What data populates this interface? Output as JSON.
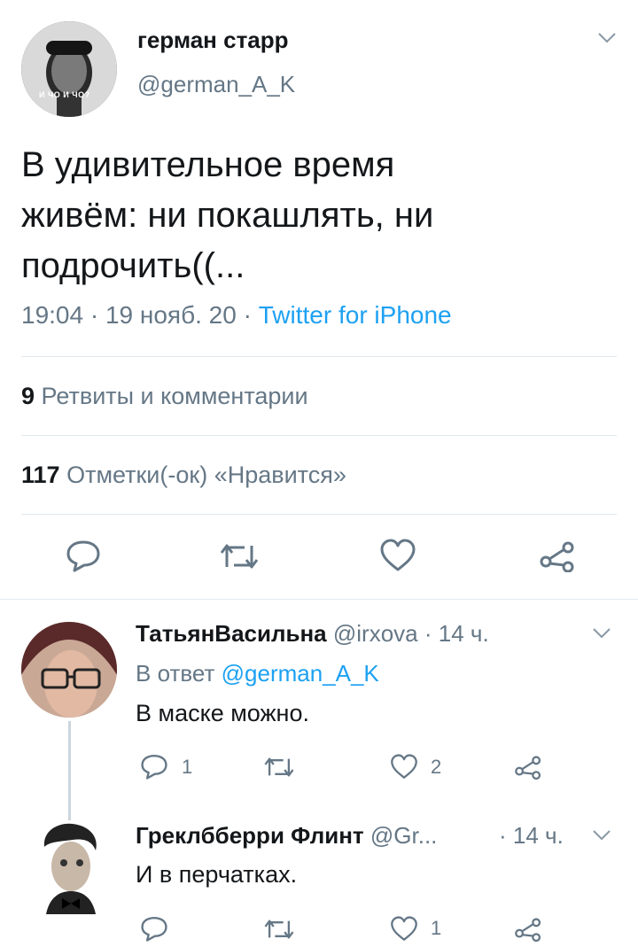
{
  "tweet": {
    "author_name": "герман старр",
    "author_handle": "@german_A_K",
    "avatar_caption": "И ЧО И ЧО?",
    "text_line1": "В удивительное время",
    "text_line2": "живём: ни покашлять, ни",
    "text_line3": "подрочить((...",
    "time": "19:04",
    "date": "19 нояб. 20",
    "source": "Twitter for iPhone",
    "separator": "·",
    "retweets_count": "9",
    "retweets_label": "Ретвиты и комментарии",
    "likes_count": "117",
    "likes_label": "Отметки(-ок) «Нравится»"
  },
  "replies": [
    {
      "name": "ТатьянВасильна",
      "handle": "@irxova",
      "time": "14 ч.",
      "separator": "·",
      "reply_to_prefix": "В ответ",
      "reply_to_handle": "@german_A_K",
      "text": "В маске можно.",
      "reply_count": "1",
      "like_count": "2"
    },
    {
      "name": "Греклбберри Флинт",
      "handle": "@Gr...",
      "time": "14 ч.",
      "separator": "·",
      "text": "И в перчатках.",
      "like_count": "1"
    }
  ],
  "colors": {
    "text": "#14171a",
    "muted": "#657786",
    "link": "#1da1f2",
    "divider": "#e1e8ed"
  },
  "icons": [
    "chevron-down-icon",
    "reply-icon",
    "retweet-icon",
    "like-icon",
    "share-icon"
  ]
}
